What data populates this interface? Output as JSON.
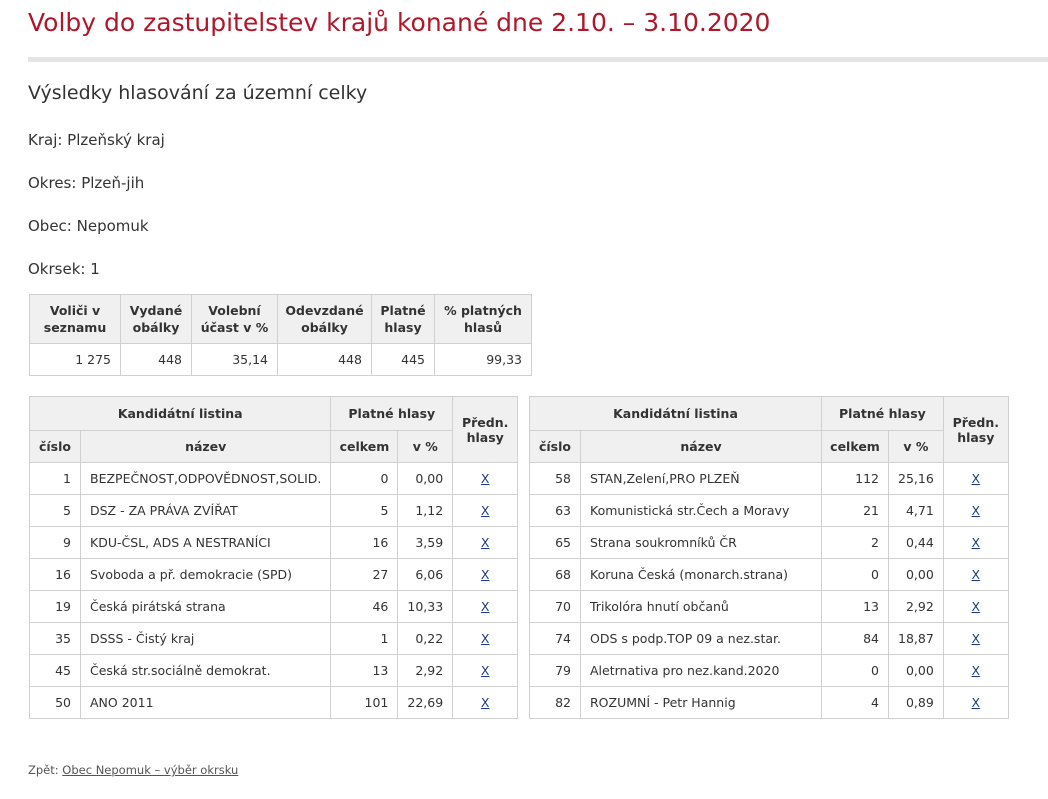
{
  "header": {
    "title": "Volby do zastupitelstev krajů konané dne 2.10. – 3.10.2020",
    "subtitle": "Výsledky hlasování za územní celky"
  },
  "location": {
    "kraj": "Kraj: Plzeňský kraj",
    "okres": "Okres: Plzeň-jih",
    "obec": "Obec: Nepomuk",
    "okrsek": "Okrsek: 1"
  },
  "summary": {
    "headers": [
      "Voliči v seznamu",
      "Vydané obálky",
      "Volební účast v %",
      "Odevzdané obálky",
      "Platné hlasy",
      "% platných hlasů"
    ],
    "values": [
      "1 275",
      "448",
      "35,14",
      "448",
      "445",
      "99,33"
    ]
  },
  "results_headers": {
    "listina": "Kandidátní listina",
    "platne": "Platné hlasy",
    "predn": "Předn. hlasy",
    "cislo": "číslo",
    "nazev": "název",
    "celkem": "celkem",
    "procent": "v %"
  },
  "results_left": [
    {
      "cislo": "1",
      "nazev": "BEZPEČNOST,ODPOVĚDNOST,SOLID.",
      "celkem": "0",
      "procent": "0,00",
      "link": "X"
    },
    {
      "cislo": "5",
      "nazev": "DSZ - ZA PRÁVA ZVÍŘAT",
      "celkem": "5",
      "procent": "1,12",
      "link": "X"
    },
    {
      "cislo": "9",
      "nazev": "KDU-ČSL, ADS A NESTRANÍCI",
      "celkem": "16",
      "procent": "3,59",
      "link": "X"
    },
    {
      "cislo": "16",
      "nazev": "Svoboda a př. demokracie (SPD)",
      "celkem": "27",
      "procent": "6,06",
      "link": "X"
    },
    {
      "cislo": "19",
      "nazev": "Česká pirátská strana",
      "celkem": "46",
      "procent": "10,33",
      "link": "X"
    },
    {
      "cislo": "35",
      "nazev": "DSSS - Čistý kraj",
      "celkem": "1",
      "procent": "0,22",
      "link": "X"
    },
    {
      "cislo": "45",
      "nazev": "Česká str.sociálně demokrat.",
      "celkem": "13",
      "procent": "2,92",
      "link": "X"
    },
    {
      "cislo": "50",
      "nazev": "ANO 2011",
      "celkem": "101",
      "procent": "22,69",
      "link": "X"
    }
  ],
  "results_right": [
    {
      "cislo": "58",
      "nazev": "STAN,Zelení,PRO PLZEŇ",
      "celkem": "112",
      "procent": "25,16",
      "link": "X"
    },
    {
      "cislo": "63",
      "nazev": "Komunistická str.Čech a Moravy",
      "celkem": "21",
      "procent": "4,71",
      "link": "X"
    },
    {
      "cislo": "65",
      "nazev": "Strana soukromníků ČR",
      "celkem": "2",
      "procent": "0,44",
      "link": "X"
    },
    {
      "cislo": "68",
      "nazev": "Koruna Česká (monarch.strana)",
      "celkem": "0",
      "procent": "0,00",
      "link": "X"
    },
    {
      "cislo": "70",
      "nazev": "Trikolóra hnutí občanů",
      "celkem": "13",
      "procent": "2,92",
      "link": "X"
    },
    {
      "cislo": "74",
      "nazev": "ODS s podp.TOP 09 a nez.star.",
      "celkem": "84",
      "procent": "18,87",
      "link": "X"
    },
    {
      "cislo": "79",
      "nazev": "Aletrnativa pro nez.kand.2020",
      "celkem": "0",
      "procent": "0,00",
      "link": "X"
    },
    {
      "cislo": "82",
      "nazev": "ROZUMNÍ - Petr Hannig",
      "celkem": "4",
      "procent": "0,89",
      "link": "X"
    }
  ],
  "footer": {
    "back_label": "Zpět:",
    "back_link": "Obec Nepomuk – výběr okrsku"
  }
}
